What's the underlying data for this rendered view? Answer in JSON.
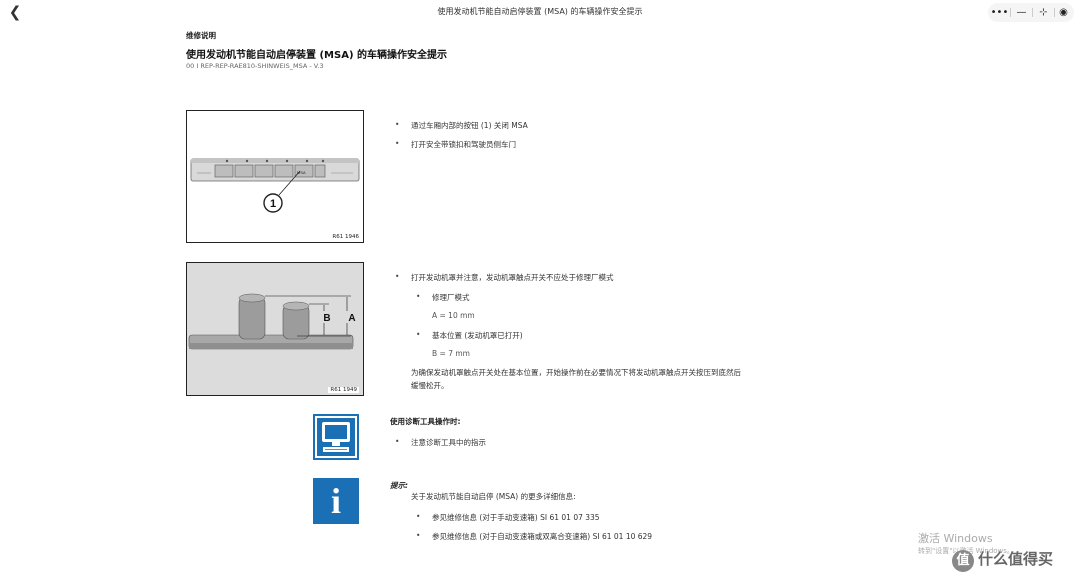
{
  "window": {
    "back_icon": "chevron-left-icon",
    "title": "使用发动机节能自动启停装置 (MSA) 的车辆操作安全提示",
    "capsule": {
      "more": "•••",
      "minimize": "—",
      "collapse": "⊹",
      "close": "◉"
    }
  },
  "doc": {
    "section_label": "维修说明",
    "title": "使用发动机节能自动启停装置 (MSA) 的车辆操作安全提示",
    "ref": "00 I REP-REP-RAE810-SHINWEIS_MSA - V.3"
  },
  "figure1": {
    "callout": "1",
    "ref": "R61 1946",
    "button_label": "MSA"
  },
  "figure2": {
    "label_a": "A",
    "label_b": "B",
    "ref": "R61 1949"
  },
  "step1": {
    "bullets": [
      "通过车厢内部的按钮 (1) 关闭 MSA",
      "打开安全带锁扣和驾驶员侧车门"
    ]
  },
  "step2": {
    "bullet": "打开发动机罩并注意，发动机罩触点开关不应处于修理厂模式",
    "sub1": "修理厂模式",
    "val1": "A = 10 mm",
    "sub2": "基本位置 (发动机罩已打开)",
    "val2": "B = 7 mm",
    "para": "为确保发动机罩触点开关处在基本位置，开始操作前在必要情况下将发动机罩触点开关按压到底然后缓慢松开。"
  },
  "diag": {
    "icon": "diagnostic-monitor-icon",
    "heading": "使用诊断工具操作时:",
    "bullet": "注意诊断工具中的指示"
  },
  "note": {
    "icon": "info-icon",
    "icon_glyph": "i",
    "heading": "提示:",
    "intro": "关于发动机节能自动启停 (MSA) 的更多详细信息:",
    "bullets": [
      "参见维修信息 (对于手动变速箱) SI 61 01 07 335",
      "参见维修信息 (对于自动变速箱或双离合变速箱) SI 61 01 10 629"
    ]
  },
  "overlay": {
    "activate_windows": "激活 Windows",
    "activate_hint": "转到\"设置\"以激活 Windows。",
    "brand_glyph": "值",
    "brand_text": "什么值得买"
  },
  "colors": {
    "icon_blue": "#1a6fb5",
    "figure_bg": "#dcdcdc"
  }
}
